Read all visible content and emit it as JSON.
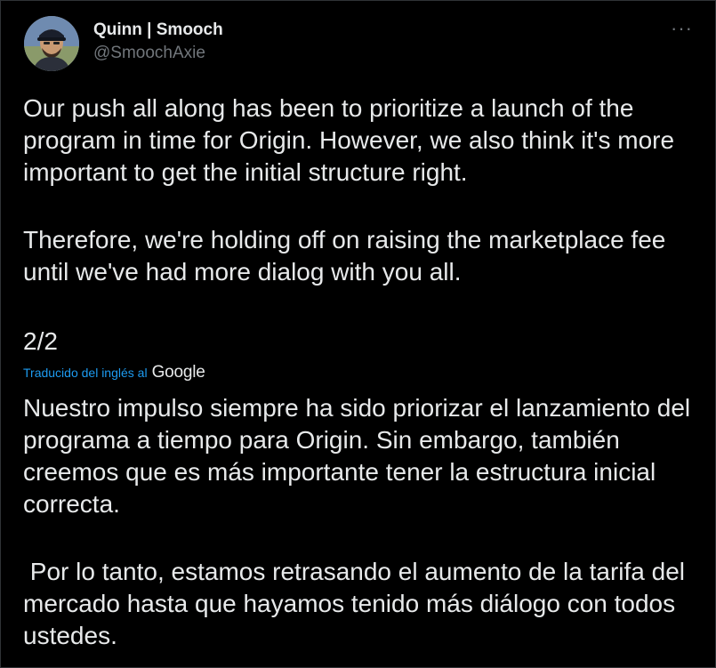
{
  "user": {
    "display_name": "Quinn | Smooch",
    "handle": "@SmoochAxie"
  },
  "menu": {
    "more_label": "···"
  },
  "tweet": {
    "paragraph_1": "Our push all along has been to prioritize a launch of the program in time for Origin. However, we also think it's more important to get the initial structure right.",
    "paragraph_2": "Therefore, we're holding off on raising the marketplace fee until we've had more dialog with you all.",
    "thread_index": "2/2"
  },
  "translation": {
    "label": "Traducido del inglés al",
    "provider": "Google",
    "paragraph_1": "Nuestro impulso siempre ha sido priorizar el lanzamiento del programa a tiempo para Origin. Sin embargo, también creemos que es más importante tener la estructura inicial correcta.",
    "paragraph_2": " Por lo tanto, estamos retrasando el aumento de la tarifa del mercado hasta que hayamos tenido más diálogo con todos ustedes."
  },
  "colors": {
    "background": "#000000",
    "text": "#e7e9ea",
    "secondary": "#71767b",
    "link": "#1d9bf0"
  }
}
